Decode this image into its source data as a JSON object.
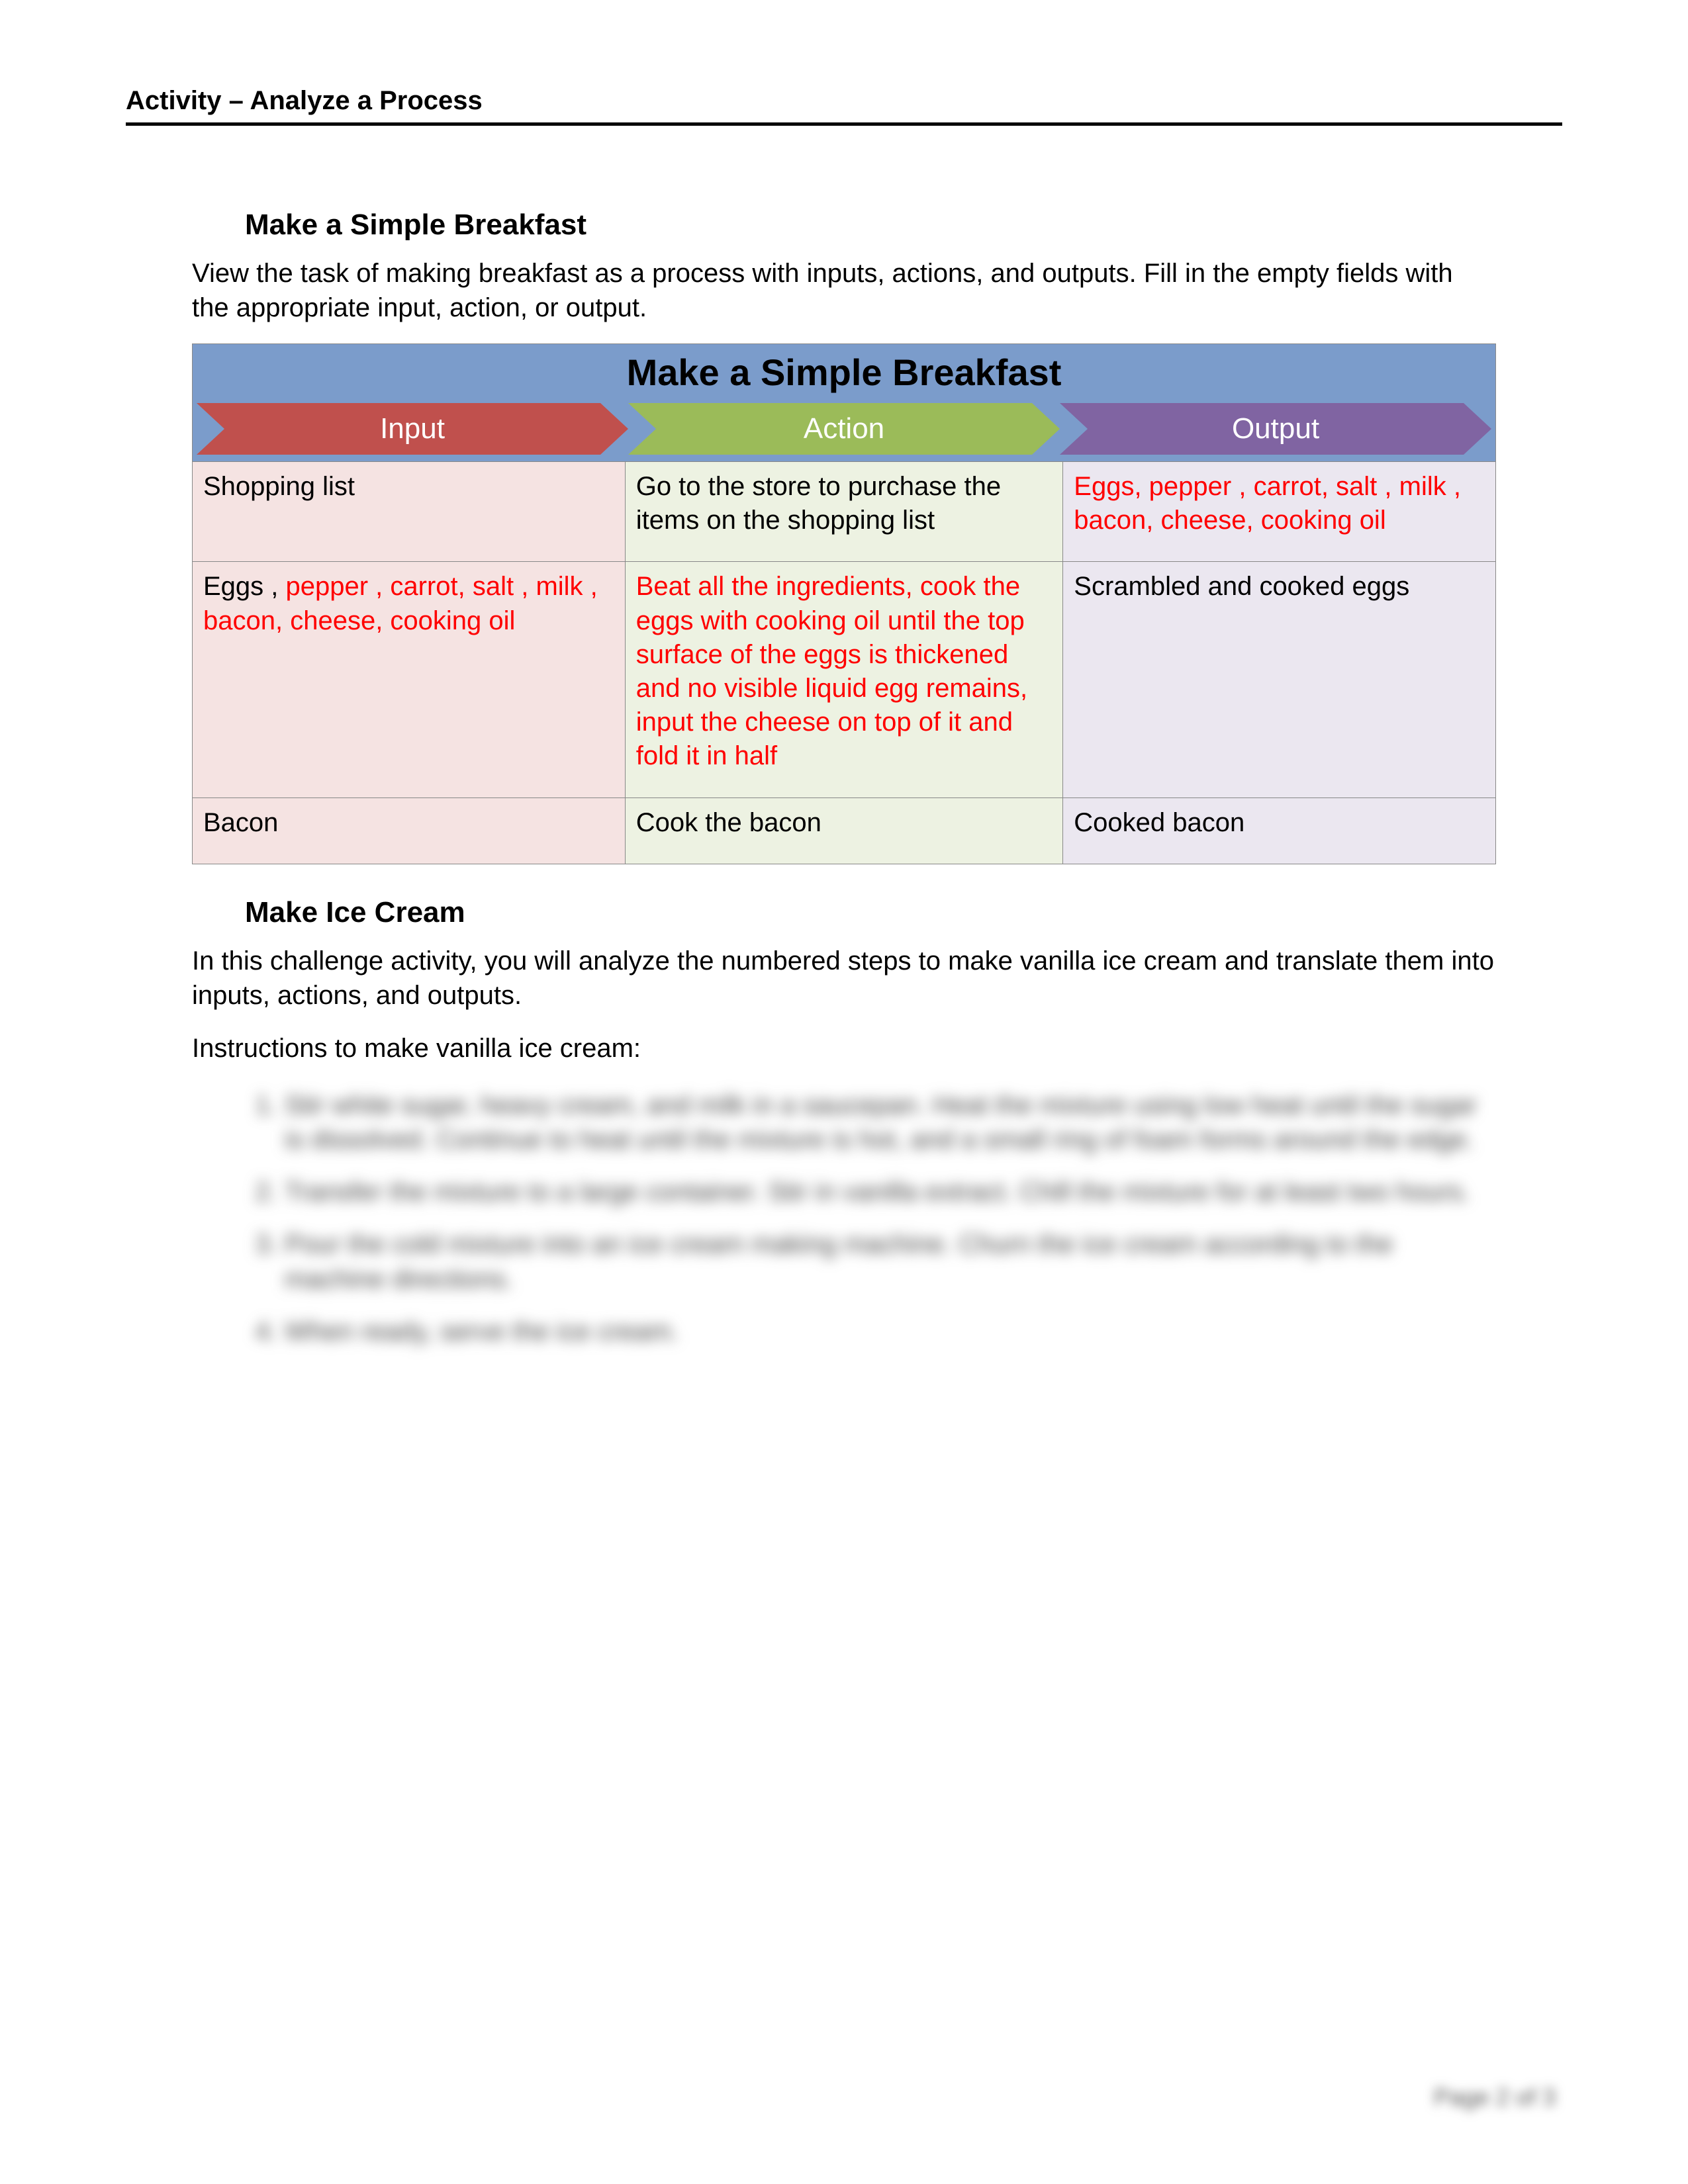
{
  "header": {
    "title": "Activity – Analyze a Process"
  },
  "section1": {
    "title": "Make a Simple Breakfast",
    "intro": "View the task of making breakfast as a process with inputs, actions, and outputs. Fill in the empty fields with the appropriate input, action, or output.",
    "table_title": "Make a Simple Breakfast",
    "columns": {
      "input": "Input",
      "action": "Action",
      "output": "Output"
    },
    "rows": [
      {
        "input_black": "Shopping list",
        "input_red": "",
        "action_black": "Go to the store to purchase the items on the shopping list",
        "action_red": "",
        "output_black": "",
        "output_red": "Eggs, pepper , carrot, salt , milk , bacon, cheese, cooking oil"
      },
      {
        "input_black": "Eggs , ",
        "input_red": "pepper , carrot, salt , milk , bacon, cheese, cooking oil",
        "action_black": "",
        "action_red": "Beat all the ingredients, cook the eggs with cooking oil until the top surface of the eggs is thickened and no visible liquid egg remains, input the cheese on top of it and fold it in half",
        "output_black": "Scrambled and cooked eggs",
        "output_red": ""
      },
      {
        "input_black": "Bacon",
        "input_red": "",
        "action_black": "Cook the bacon",
        "action_red": "",
        "output_black": "Cooked bacon",
        "output_red": ""
      }
    ]
  },
  "section2": {
    "title": "Make Ice Cream",
    "para1": "In this challenge activity, you will analyze the numbered steps to make vanilla ice cream and translate them into inputs, actions, and outputs.",
    "para2": "Instructions to make vanilla ice cream:",
    "steps": [
      "Stir white sugar, heavy cream, and milk in a saucepan. Heat the mixture using low heat until the sugar is dissolved. Continue to heat until the mixture is hot, and a small ring of foam forms around the edge.",
      "Transfer the mixture to a large container. Stir in vanilla extract. Chill the mixture for at least two hours.",
      "Pour the cold mixture into an ice cream making machine. Churn the ice cream according to the machine directions.",
      "When ready, serve the ice cream."
    ]
  },
  "footer": {
    "page": "Page 2 of 3"
  }
}
